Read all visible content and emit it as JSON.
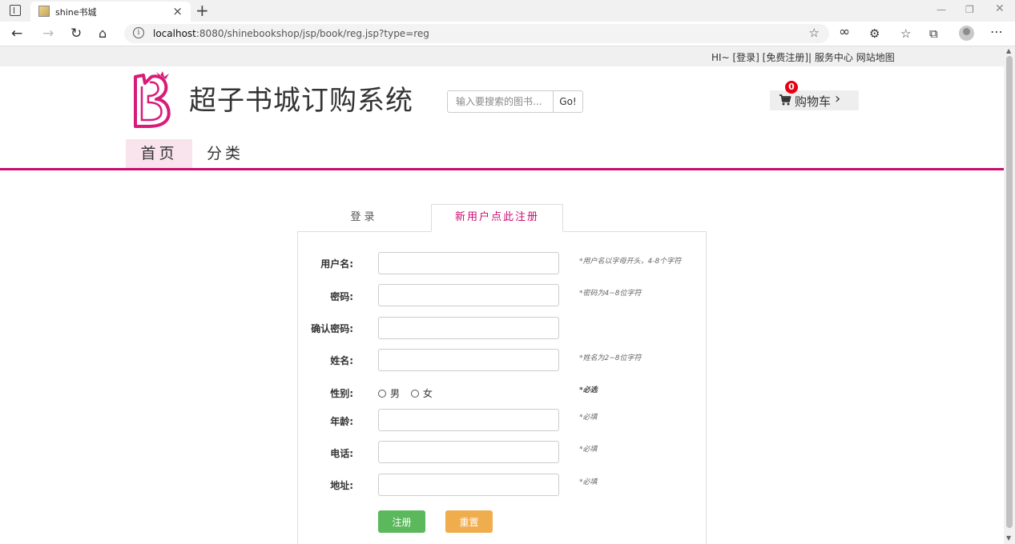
{
  "browser": {
    "tab_title": "shine书城",
    "url_host": "localhost",
    "url_rest": ":8080/shinebookshop/jsp/book/reg.jsp?type=reg"
  },
  "topbar": {
    "greeting": "HI~",
    "login": "[登录]",
    "register": "[免费注册]",
    "divider": "|",
    "service": "服务中心",
    "sitemap": "网站地图"
  },
  "header": {
    "title": "超子书城订购系统",
    "search_placeholder": "输入要搜索的图书...",
    "search_button": "Go!",
    "cart_label": "购物车",
    "cart_count": "0"
  },
  "nav": {
    "items": [
      {
        "label": "首页",
        "active": true
      },
      {
        "label": "分类",
        "active": false
      }
    ]
  },
  "form": {
    "tabs": {
      "login": "登录",
      "register": "新用户点此注册"
    },
    "fields": [
      {
        "label": "用户名:",
        "hint": "*用户名以字母开头，4-8个字符"
      },
      {
        "label": "密码:",
        "hint": "*密码为4~8位字符"
      },
      {
        "label": "确认密码:",
        "hint": ""
      },
      {
        "label": "姓名:",
        "hint": "*姓名为2~8位字符"
      },
      {
        "label": "性别:",
        "hint": "*必选"
      },
      {
        "label": "年龄:",
        "hint": "*必填"
      },
      {
        "label": "电话:",
        "hint": "*必填"
      },
      {
        "label": "地址:",
        "hint": "*必填"
      }
    ],
    "gender_options": [
      "男",
      "女"
    ],
    "submit_label": "注册",
    "reset_label": "重置"
  },
  "colors": {
    "brand": "#c90c6e",
    "nav_active_bg": "#f9e3ec",
    "submit": "#5cb85c",
    "reset": "#f0ad4e",
    "badge": "#e60012"
  },
  "icons": [
    "tabs-icon",
    "favicon-icon",
    "close-icon",
    "plus-icon",
    "back-icon",
    "forward-icon",
    "refresh-icon",
    "home-icon",
    "info-icon",
    "favorite-add-icon",
    "infinity-icon",
    "extensions-icon",
    "favorites-icon",
    "collections-icon",
    "profile-icon",
    "more-icon",
    "cart-icon",
    "chevron-right-icon"
  ]
}
